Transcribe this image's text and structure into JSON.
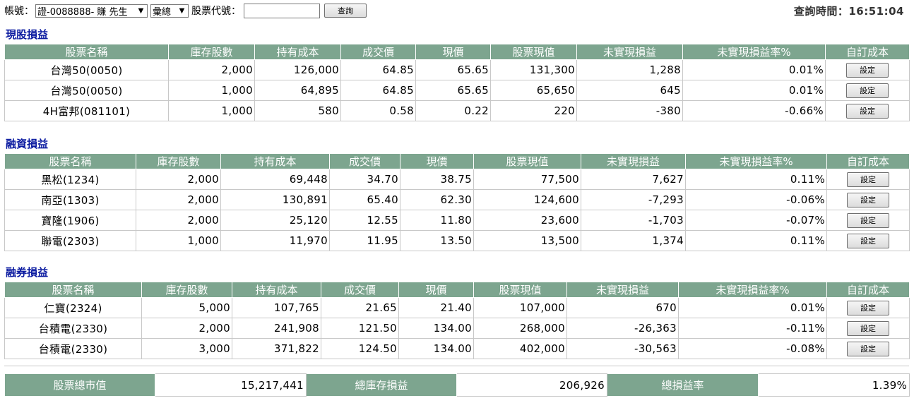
{
  "top": {
    "account_label": "帳號：",
    "account_value": "證-0088888- 賺 先生",
    "mode_value": "彙總",
    "stock_code_label": "股票代號：",
    "stock_code_value": "",
    "query_button": "查詢",
    "query_time_label": "查詢時間：",
    "query_time": "16:51:04"
  },
  "columns": [
    "股票名稱",
    "庫存股數",
    "持有成本",
    "成交價",
    "現價",
    "股票現值",
    "未實現損益",
    "未實現損益率%",
    "自訂成本"
  ],
  "set_label": "設定",
  "sections": [
    {
      "title": "現股損益",
      "rows": [
        [
          "台灣50(0050)",
          "2,000",
          "126,000",
          "64.85",
          "65.65",
          "131,300",
          "1,288",
          "0.01%"
        ],
        [
          "台灣50(0050)",
          "1,000",
          "64,895",
          "64.85",
          "65.65",
          "65,650",
          "645",
          "0.01%"
        ],
        [
          "4H富邦(081101)",
          "1,000",
          "580",
          "0.58",
          "0.22",
          "220",
          "-380",
          "-0.66%"
        ]
      ]
    },
    {
      "title": "融資損益",
      "rows": [
        [
          "黑松(1234)",
          "2,000",
          "69,448",
          "34.70",
          "38.75",
          "77,500",
          "7,627",
          "0.11%"
        ],
        [
          "南亞(1303)",
          "2,000",
          "130,891",
          "65.40",
          "62.30",
          "124,600",
          "-7,293",
          "-0.06%"
        ],
        [
          "寶隆(1906)",
          "2,000",
          "25,120",
          "12.55",
          "11.80",
          "23,600",
          "-1,703",
          "-0.07%"
        ],
        [
          "聯電(2303)",
          "1,000",
          "11,970",
          "11.95",
          "13.50",
          "13,500",
          "1,374",
          "0.11%"
        ]
      ]
    },
    {
      "title": "融券損益",
      "rows": [
        [
          "仁寶(2324)",
          "5,000",
          "107,765",
          "21.65",
          "21.40",
          "107,000",
          "670",
          "0.01%"
        ],
        [
          "台積電(2330)",
          "2,000",
          "241,908",
          "121.50",
          "134.00",
          "268,000",
          "-26,363",
          "-0.11%"
        ],
        [
          "台積電(2330)",
          "3,000",
          "371,822",
          "124.50",
          "134.00",
          "402,000",
          "-30,563",
          "-0.08%"
        ]
      ]
    }
  ],
  "totals": {
    "market_value_label": "股票總市值",
    "market_value": "15,217,441",
    "inventory_pl_label": "總庫存損益",
    "inventory_pl": "206,926",
    "total_rate_label": "總損益率",
    "total_rate": "1.39%"
  },
  "colors": {
    "header_bg": "#7da58f",
    "title": "#0a1aa0"
  }
}
